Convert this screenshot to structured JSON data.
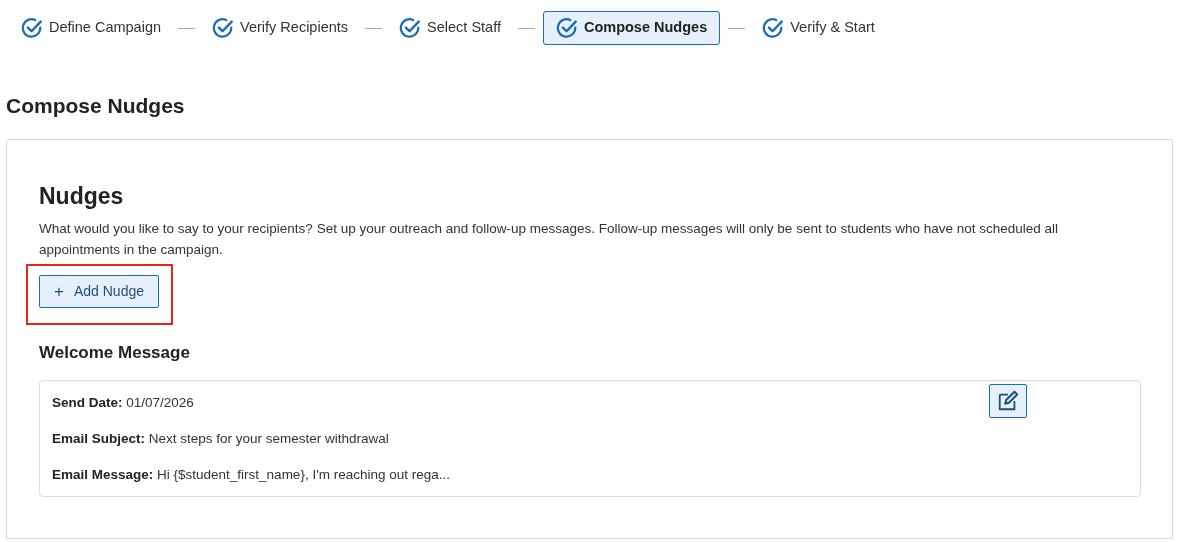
{
  "steps": [
    {
      "label": "Define Campaign",
      "selected": false
    },
    {
      "label": "Verify Recipients",
      "selected": false
    },
    {
      "label": "Select Staff",
      "selected": false
    },
    {
      "label": "Compose Nudges",
      "selected": true
    },
    {
      "label": "Verify & Start",
      "selected": false
    }
  ],
  "page_title": "Compose Nudges",
  "nudges": {
    "heading": "Nudges",
    "description": "What would you like to say to your recipients? Set up your outreach and follow-up messages. Follow-up messages will only be sent to students who have not scheduled all appointments in the campaign.",
    "add_button": {
      "icon": "+",
      "label": "Add Nudge",
      "highlighted": true
    },
    "messages": [
      {
        "title": "Welcome Message",
        "fields": [
          {
            "label": "Send Date:",
            "value": "01/07/2026"
          },
          {
            "label": "Email Subject:",
            "value": "Next steps for your semester withdrawal"
          },
          {
            "label": "Email Message:",
            "value": "Hi {$student_first_name}, I'm reaching out rega..."
          }
        ]
      }
    ]
  }
}
